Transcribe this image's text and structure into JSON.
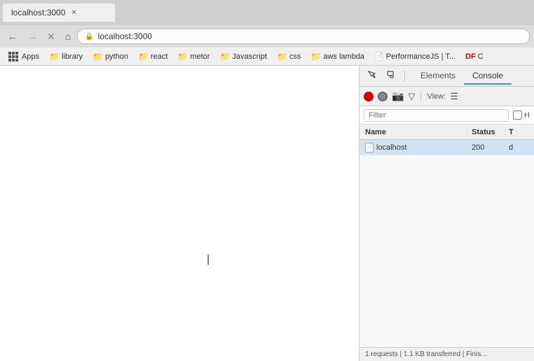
{
  "browser": {
    "tab_title": "localhost:3000",
    "address": "localhost:3000",
    "back_label": "←",
    "forward_label": "→",
    "reload_label": "↻",
    "close_nav_label": "✕",
    "home_label": "⌂"
  },
  "bookmarks": {
    "items": [
      {
        "label": "Apps",
        "type": "apps"
      },
      {
        "label": "library",
        "type": "folder"
      },
      {
        "label": "python",
        "type": "folder"
      },
      {
        "label": "react",
        "type": "folder"
      },
      {
        "label": "metor",
        "type": "folder"
      },
      {
        "label": "Javascript",
        "type": "folder"
      },
      {
        "label": "css",
        "type": "folder"
      },
      {
        "label": "aws lambda",
        "type": "folder"
      },
      {
        "label": "PerformanceJS | T...",
        "type": "page"
      },
      {
        "label": "DF C",
        "type": "other"
      }
    ]
  },
  "devtools": {
    "tab_elements": "Elements",
    "tab_console": "Console",
    "filter_placeholder": "Filter",
    "hide_label": "H",
    "view_label": "View:",
    "network_table": {
      "col_name": "Name",
      "col_status": "Status",
      "col_type": "T",
      "rows": [
        {
          "name": "localhost",
          "status": "200",
          "type": "d"
        }
      ]
    },
    "status_bar": "1 requests | 1.1 KB transferred | Finis..."
  }
}
